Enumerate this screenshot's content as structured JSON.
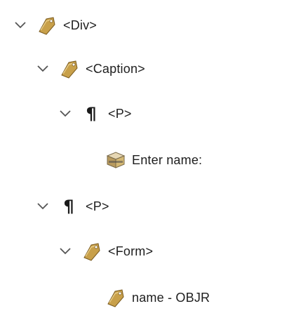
{
  "tree": {
    "nodes": [
      {
        "label": "<Div>",
        "icon": "tag-icon",
        "expanded": true
      },
      {
        "label": "<Caption>",
        "icon": "tag-icon",
        "expanded": true
      },
      {
        "label": "<P>",
        "icon": "paragraph-icon",
        "expanded": true
      },
      {
        "label": "Enter name:",
        "icon": "content-box-icon"
      },
      {
        "label": "<P>",
        "icon": "paragraph-icon",
        "expanded": true
      },
      {
        "label": "<Form>",
        "icon": "tag-icon",
        "expanded": true
      },
      {
        "label": "name - OBJR",
        "icon": "tag-icon"
      }
    ]
  },
  "colors": {
    "tag_fill": "#c8a04a",
    "tag_stroke": "#7a5a1e",
    "chevron": "#555555",
    "text": "#1e1e1e"
  }
}
